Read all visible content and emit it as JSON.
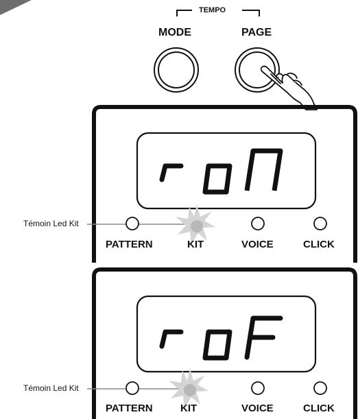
{
  "header": {
    "tempo_label": "TEMPO"
  },
  "buttons": {
    "mode_label": "MODE",
    "page_label": "PAGE"
  },
  "panels": [
    {
      "display_text": "roN",
      "callout": "Témoin Led Kit",
      "indicators": [
        "PATTERN",
        "KIT",
        "VOICE",
        "CLICK"
      ],
      "lit_indicator": "KIT"
    },
    {
      "display_text": "roF",
      "callout": "Témoin Led Kit",
      "indicators": [
        "PATTERN",
        "KIT",
        "VOICE",
        "CLICK"
      ],
      "lit_indicator": "KIT"
    }
  ],
  "colors": {
    "frame": "#111111",
    "led_lit": "#b8b8b8",
    "led_glow": "#d4d4d4",
    "corner_tab": "#6e6e6e"
  }
}
